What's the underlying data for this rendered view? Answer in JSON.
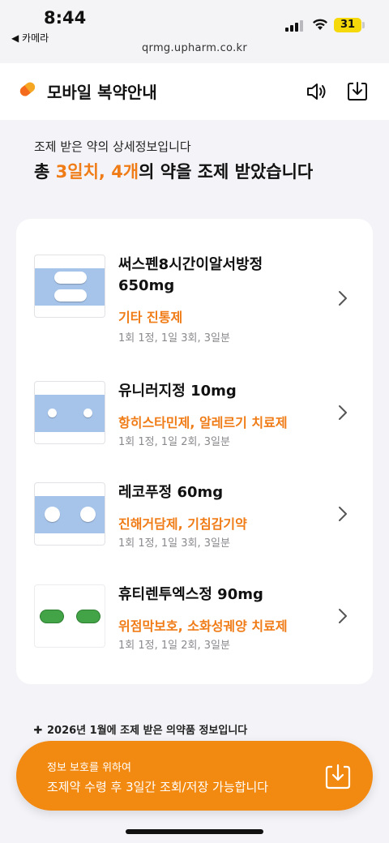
{
  "status_bar": {
    "time": "8:44",
    "back_app": "◀ 카메라",
    "url": "qrmg.upharm.co.kr",
    "battery": "31"
  },
  "header": {
    "title": "모바일 복약안내",
    "icons": [
      "speaker-icon",
      "download-icon"
    ]
  },
  "intro": {
    "subtitle": "조제 받은 약의 상세정보입니다",
    "headline_prefix": "총 ",
    "headline_days": "3일치, ",
    "headline_count": "4개",
    "headline_suffix": "의 약을 조제 받았습니다"
  },
  "medications": [
    {
      "name_line1": "써스펜8시간이알서방정",
      "name_line2": "650mg",
      "category": "기타 진통제",
      "dosage": "1회 1정, 1일 3회, 3일분",
      "pill_image": "white-oval-tablets"
    },
    {
      "name_line1": "유니러지정 10mg",
      "name_line2": "",
      "category": "항히스타민제, 알레르기 치료제",
      "dosage": "1회 1정, 1일 2회, 3일분",
      "pill_image": "white-small-round-tablets"
    },
    {
      "name_line1": "레코푸정 60mg",
      "name_line2": "",
      "category": "진해거담제, 기침감기약",
      "dosage": "1회 1정, 1일 3회, 3일분",
      "pill_image": "white-round-tablets"
    },
    {
      "name_line1": "휴티렌투엑스정 90mg",
      "name_line2": "",
      "category": "위점막보호, 소화성궤양 치료제",
      "dosage": "1회 1정, 1일 2회, 3일분",
      "pill_image": "green-oval-tablets"
    }
  ],
  "footnote": {
    "icon": "plus-icon",
    "text": "2026년 1월에 조제 받은 의약품 정보입니다"
  },
  "banner": {
    "small_text": "정보 보호를 위하여",
    "main_text": "조제약 수령 후 3일간 조회/저장 가능합니다",
    "icon": "download-icon"
  },
  "colors": {
    "accent": "#f07c17",
    "banner": "#f28a12",
    "background": "#f4f4f8",
    "pill_band": "#a6c4ea"
  }
}
